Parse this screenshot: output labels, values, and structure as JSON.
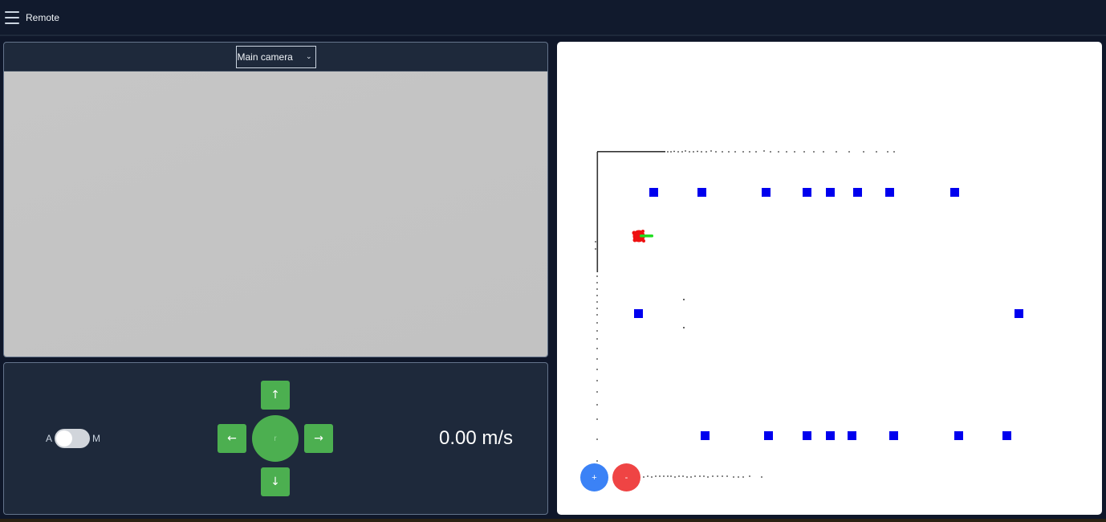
{
  "app": {
    "title": "Remote"
  },
  "camera": {
    "selected": "Main camera"
  },
  "controls": {
    "mode_left": "A",
    "mode_right": "M",
    "up": "↑",
    "down": "↓",
    "left": "←",
    "right": "→",
    "joystick_label": "r",
    "speed": "0.00 m/s"
  },
  "map": {
    "zoom_in": "+",
    "zoom_out": "-"
  },
  "colors": {
    "background": "#0f172a",
    "panel": "#1e293b",
    "button_green": "#4caf50",
    "zoom_in_blue": "#3b82f6",
    "zoom_out_red": "#ef4444",
    "map_marker_blue": "#0000ee"
  }
}
